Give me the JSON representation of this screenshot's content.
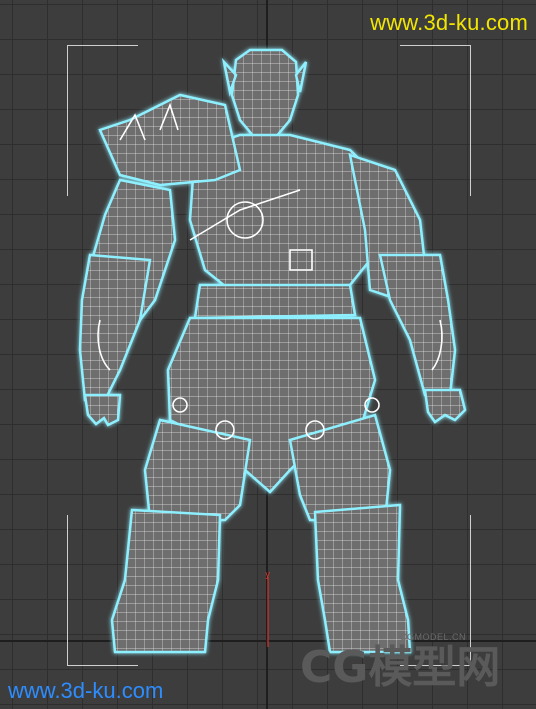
{
  "viewport": {
    "watermark_top": "www.3d-ku.com",
    "watermark_bottom": "www.3d-ku.com",
    "logo_brand": "CG模型网",
    "logo_small": "CGMODEL.CN",
    "axis_y_label": "y",
    "colors": {
      "background": "#3d3d3d",
      "grid": "#2e2e2e",
      "wire_glow": "#66e0ff",
      "wire": "#ffffff",
      "mesh_fill": "#707070",
      "watermark_top": "#f2e600",
      "watermark_bottom": "#2d8dff"
    }
  }
}
